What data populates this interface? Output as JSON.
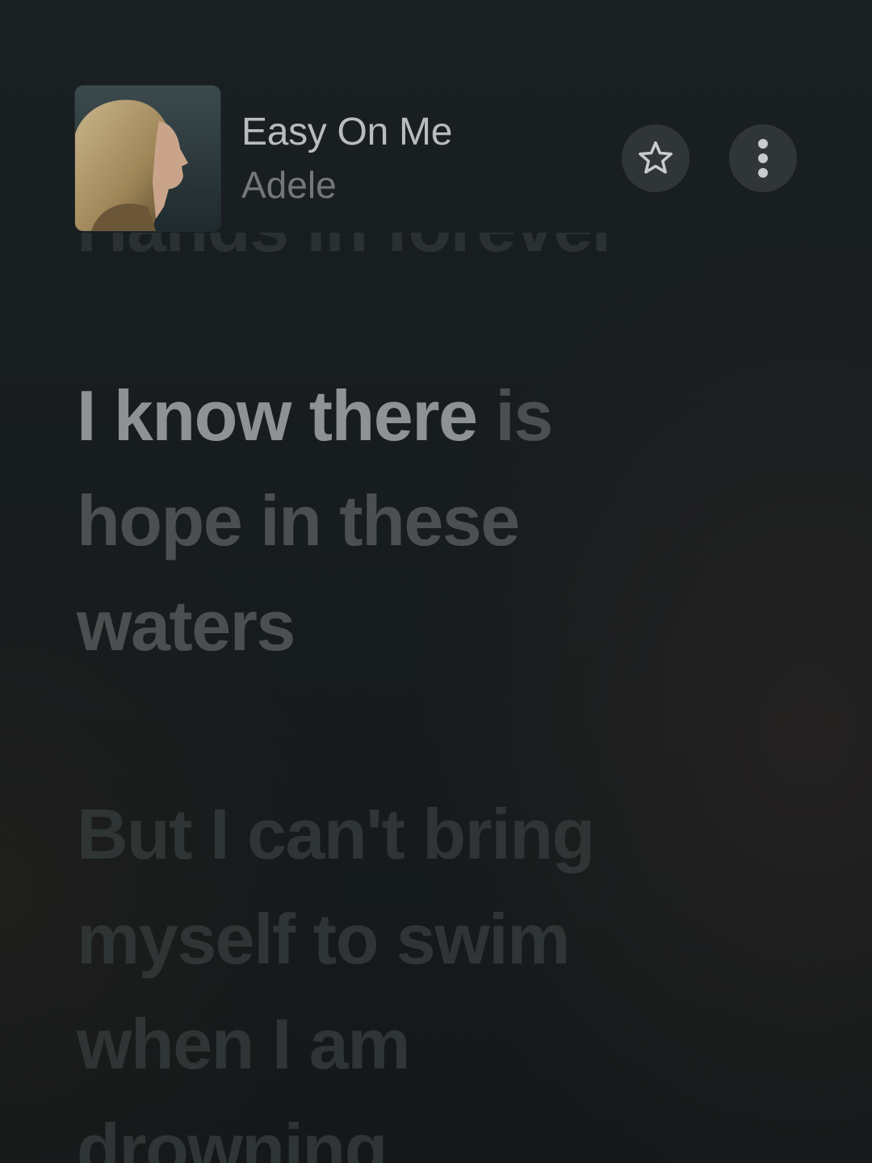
{
  "now_playing": {
    "title": "Easy On Me",
    "artist": "Adele",
    "artwork_icon": "album-art-portrait",
    "favorite_icon": "star-outline-icon",
    "more_icon": "vertical-ellipsis-icon"
  },
  "lyrics": {
    "previous_line": "Hands in forever",
    "active_line": {
      "sung": "I know there",
      "unsung_first_row": " is",
      "rest_rows": [
        "hope in these",
        "waters"
      ]
    },
    "next_line": {
      "rows": [
        "But I can't bring",
        "myself to swim",
        "when I am",
        "drowning"
      ]
    }
  },
  "colors": {
    "background": "#151a1c",
    "button_bg": "#303536",
    "title": "#b9bcbd",
    "artist": "#737779",
    "lyric_sung": "#8f9293",
    "lyric_unsung": "#4b4f50",
    "lyric_inactive": "#2f3435"
  }
}
